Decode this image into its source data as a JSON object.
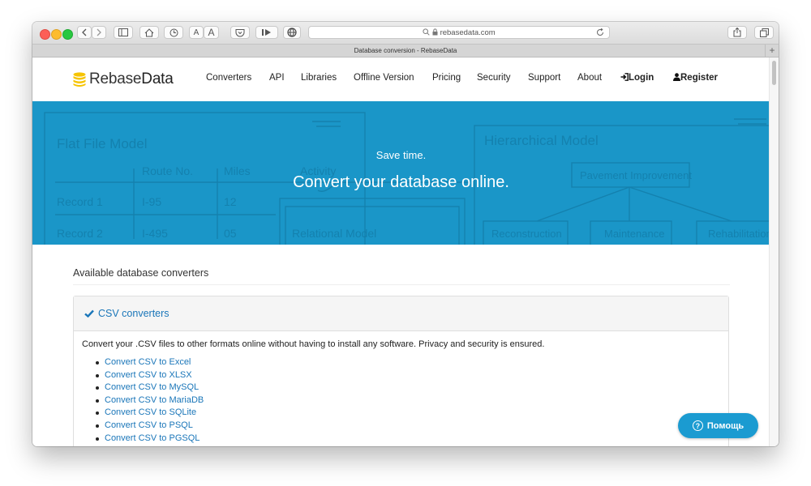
{
  "browser": {
    "url": "rebasedata.com",
    "tab_title": "Database conversion - RebaseData",
    "new_tab_symbol": "+",
    "reader_aa_small": "A",
    "reader_aa_large": "A"
  },
  "site": {
    "logo": {
      "part1": "Rebase",
      "part2": "Data",
      "icon": "database-stack-icon",
      "color": "#f6c400"
    },
    "nav": {
      "converters": "Converters",
      "api": "API",
      "libraries": "Libraries",
      "offline": "Offline Version",
      "pricing": "Pricing",
      "security": "Security",
      "support": "Support",
      "about": "About",
      "login": "Login",
      "register": "Register"
    }
  },
  "hero": {
    "kicker": "Save time.",
    "headline": "Convert your database online.",
    "background_color": "#1a96c8",
    "bg_text": {
      "flat_model": "Flat File Model",
      "route_no": "Route No.",
      "miles": "Miles",
      "activity": "Activity",
      "record1": "Record 1",
      "record1_route": "I-95",
      "record1_miles": "12",
      "record2": "Record 2",
      "record2_route": "I-495",
      "record2_miles": "05",
      "relational": "Relational Model",
      "hierarchical": "Hierarchical Model",
      "pavement": "Pavement Improvement",
      "reconstruction": "Reconstruction",
      "maintenance": "Maintenance",
      "rehabilitation": "Rehabilitation"
    }
  },
  "content": {
    "section_title": "Available database converters",
    "panel": {
      "title": "CSV converters",
      "icon": "checkmark-icon",
      "description": "Convert your .CSV files to other formats online without having to install any software. Privacy and security is ensured.",
      "links": [
        "Convert CSV to Excel",
        "Convert CSV to XLSX",
        "Convert CSV to MySQL",
        "Convert CSV to MariaDB",
        "Convert CSV to SQLite",
        "Convert CSV to PSQL",
        "Convert CSV to PGSQL"
      ]
    }
  },
  "help_widget": {
    "label": "Помощь",
    "icon": "question-circle-icon",
    "glyph": "?"
  },
  "colors": {
    "link": "#1a76b9",
    "accent": "#1b9bd1"
  }
}
